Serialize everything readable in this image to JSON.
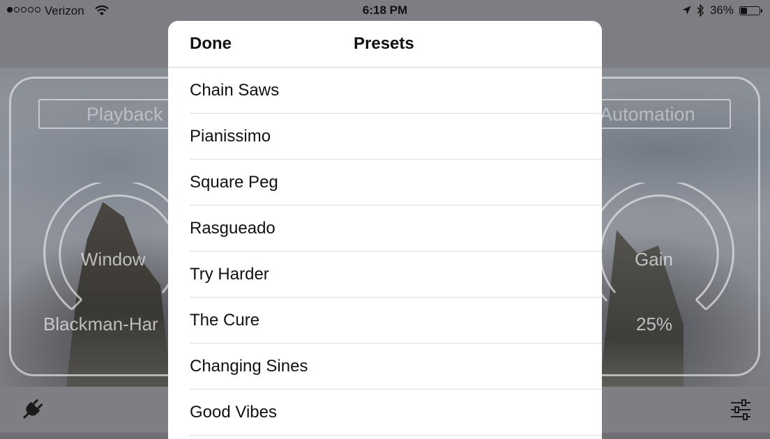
{
  "status_bar": {
    "signal_strength": 1,
    "signal_dots": 5,
    "carrier": "Verizon",
    "time": "6:18 PM",
    "battery_percent": "36%",
    "battery_level": 0.36,
    "icons": [
      "wifi-icon",
      "location-arrow-icon",
      "bluetooth-icon",
      "battery-icon"
    ]
  },
  "background_app": {
    "playback_button": "Playback",
    "automation_button": "Automation",
    "window_knob": {
      "label": "Window",
      "value": "Blackman-Har"
    },
    "gain_knob": {
      "label": "Gain",
      "value": "25%"
    },
    "toolbar_icons": [
      "plug-icon",
      "sliders-icon"
    ]
  },
  "presets_sheet": {
    "done_label": "Done",
    "title": "Presets",
    "items": [
      "Chain Saws",
      "Pianissimo",
      "Square Peg",
      "Rasgueado",
      "Try Harder",
      "The Cure",
      "Changing Sines",
      "Good Vibes"
    ]
  }
}
